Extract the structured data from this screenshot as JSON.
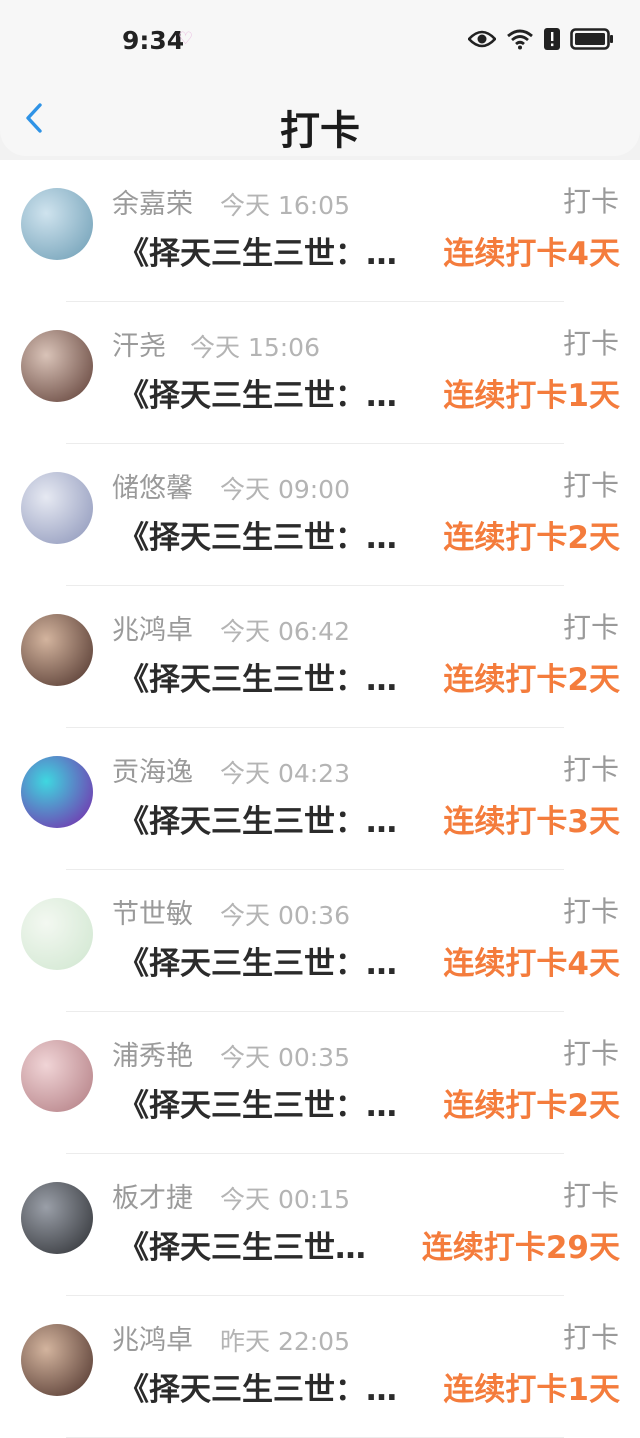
{
  "status": {
    "time": "9:34"
  },
  "nav": {
    "title": "打卡"
  },
  "colors": {
    "accent": "#f47c3c",
    "back": "#2f93e6"
  },
  "records": [
    {
      "name": "余嘉荣",
      "time": "今天 16:05",
      "tag": "打卡",
      "book": "《择天三生三世：…",
      "streak": "连续打卡4天",
      "avatar": [
        "#cfe3ee",
        "#6a9bb3"
      ]
    },
    {
      "name": "汗尧",
      "time": "今天 15:06",
      "tag": "打卡",
      "book": "《择天三生三世：…",
      "streak": "连续打卡1天",
      "avatar": [
        "#d9c3b8",
        "#5b3a32"
      ]
    },
    {
      "name": "储悠馨",
      "time": "今天 09:00",
      "tag": "打卡",
      "book": "《择天三生三世：…",
      "streak": "连续打卡2天",
      "avatar": [
        "#e6e9f2",
        "#8a93b8"
      ]
    },
    {
      "name": "兆鸿卓",
      "time": "今天 06:42",
      "tag": "打卡",
      "book": "《择天三生三世：…",
      "streak": "连续打卡2天",
      "avatar": [
        "#d3b49e",
        "#4a2f28"
      ]
    },
    {
      "name": "贡海逸",
      "time": "今天 04:23",
      "tag": "打卡",
      "book": "《择天三生三世：…",
      "streak": "连续打卡3天",
      "avatar": [
        "#3fd7e0",
        "#7b1fa8"
      ]
    },
    {
      "name": "节世敏",
      "time": "今天 00:36",
      "tag": "打卡",
      "book": "《择天三生三世：…",
      "streak": "连续打卡4天",
      "avatar": [
        "#f3f8f1",
        "#cfe6cf"
      ]
    },
    {
      "name": "浦秀艳",
      "time": "今天 00:35",
      "tag": "打卡",
      "book": "《择天三生三世：…",
      "streak": "连续打卡2天",
      "avatar": [
        "#f0d4d6",
        "#b07a80"
      ]
    },
    {
      "name": "板才捷",
      "time": "今天 00:15",
      "tag": "打卡",
      "book": "《择天三生三世…",
      "streak": "连续打卡29天",
      "avatar": [
        "#9a9fa8",
        "#2a2c30"
      ]
    },
    {
      "name": "兆鸿卓",
      "time": "昨天 22:05",
      "tag": "打卡",
      "book": "《择天三生三世：…",
      "streak": "连续打卡1天",
      "avatar": [
        "#d3b49e",
        "#4a2f28"
      ]
    }
  ]
}
